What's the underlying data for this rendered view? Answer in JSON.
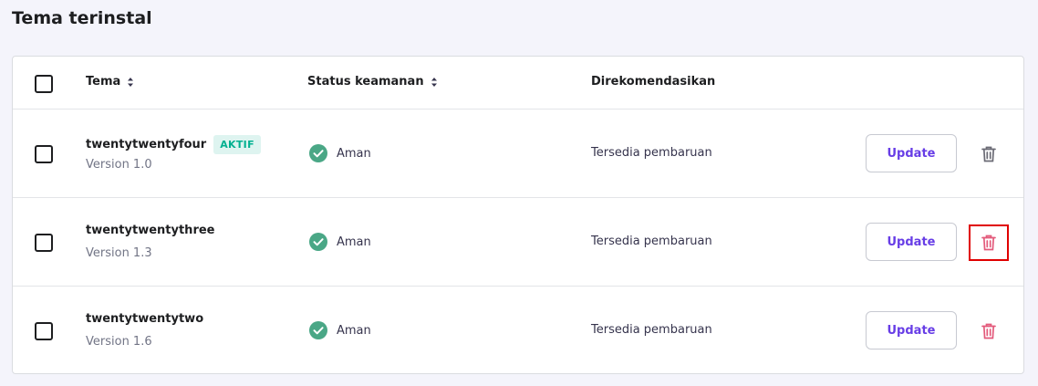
{
  "page": {
    "title": "Tema terinstal"
  },
  "table": {
    "headers": {
      "theme": "Tema",
      "security_status": "Status keamanan",
      "recommended": "Direkomendasikan"
    },
    "rows": [
      {
        "name": "twentytwentyfour",
        "badge": "AKTIF",
        "version": "Version 1.0",
        "status": "Aman",
        "recommendation": "Tersedia pembaruan",
        "update_label": "Update",
        "delete_icon_color": "#6b6b75",
        "delete_highlighted": false
      },
      {
        "name": "twentytwentythree",
        "badge": "",
        "version": "Version 1.3",
        "status": "Aman",
        "recommendation": "Tersedia pembaruan",
        "update_label": "Update",
        "delete_icon_color": "#e35a7b",
        "delete_highlighted": true
      },
      {
        "name": "twentytwentytwo",
        "badge": "",
        "version": "Version 1.6",
        "status": "Aman",
        "recommendation": "Tersedia pembaruan",
        "update_label": "Update",
        "delete_icon_color": "#e35a7b",
        "delete_highlighted": false
      }
    ]
  },
  "colors": {
    "status_ok": "#4aa786",
    "accent": "#673de6",
    "badge_text": "#00b090",
    "badge_bg": "#def4f0",
    "highlight_border": "#e00000"
  }
}
